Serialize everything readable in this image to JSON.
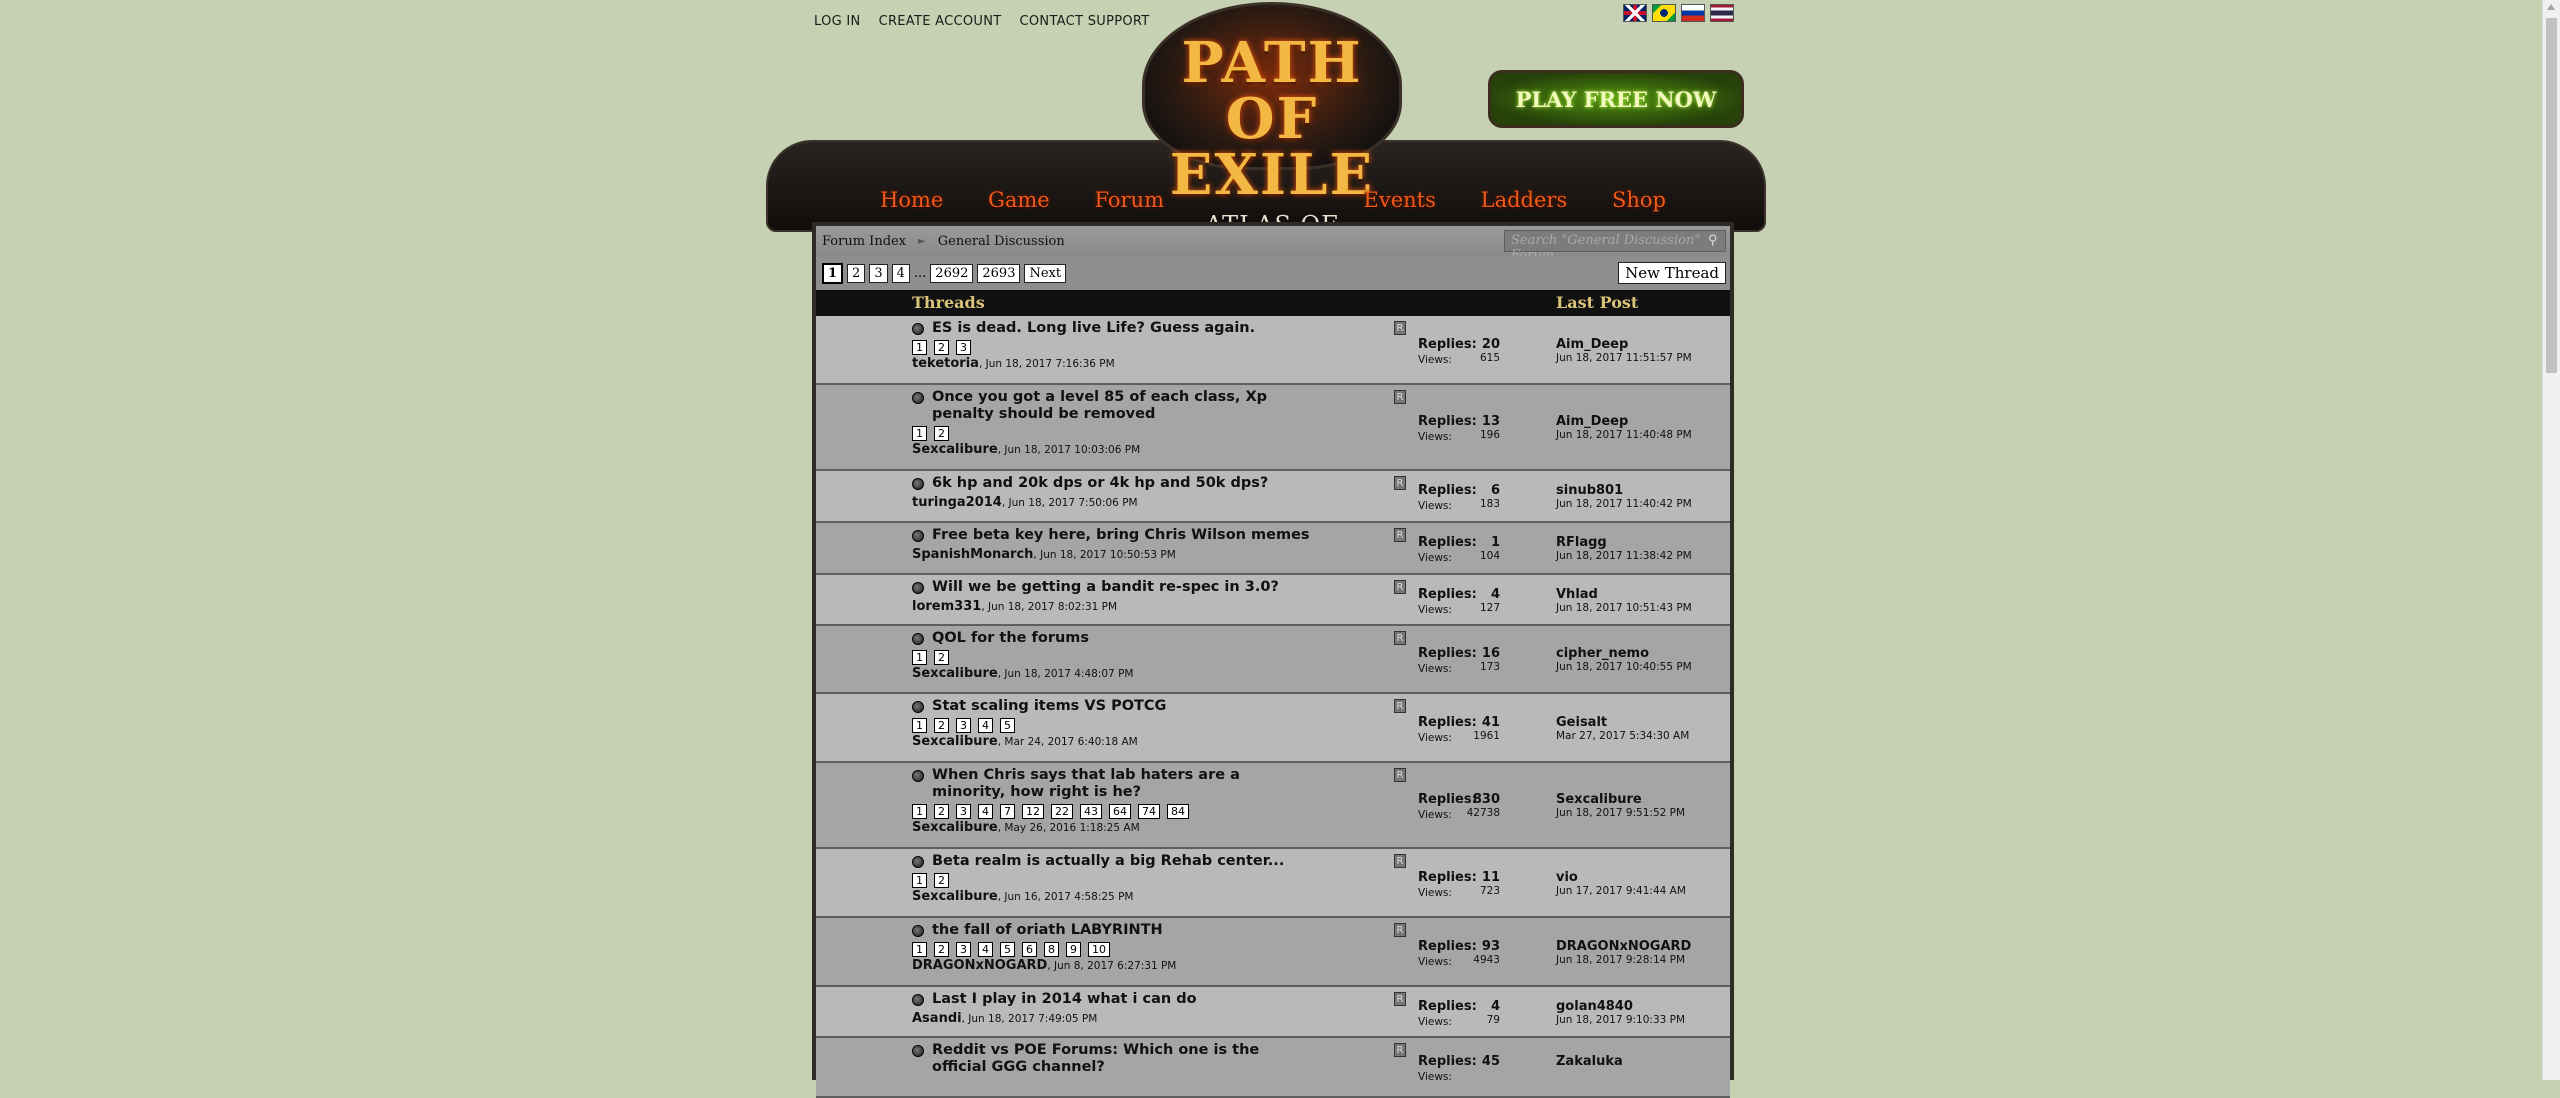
{
  "top_links": [
    "LOG IN",
    "CREATE ACCOUNT",
    "CONTACT SUPPORT"
  ],
  "flags": [
    "uk-flag",
    "brazil-flag",
    "russia-flag",
    "thailand-flag"
  ],
  "logo": {
    "main": "PATH OF EXILE",
    "sub": "ATLAS OF WORLDS"
  },
  "play_button": "PLAY FREE NOW",
  "nav": [
    "Home",
    "Game",
    "Forum",
    "Events",
    "Ladders",
    "Shop"
  ],
  "breadcrumb": {
    "root": "Forum Index",
    "current": "General Discussion"
  },
  "search": {
    "placeholder": "Search \"General Discussion\" Forum"
  },
  "pagination": {
    "pages": [
      "1",
      "2",
      "3",
      "4"
    ],
    "ellipsis": "...",
    "tail": [
      "2692",
      "2693"
    ],
    "next": "Next",
    "current": "1"
  },
  "new_thread": "New Thread",
  "table_headers": {
    "threads": "Threads",
    "last_post": "Last Post"
  },
  "labels": {
    "replies": "Replies:",
    "views": "Views:",
    "report": "R"
  },
  "threads": [
    {
      "title": "ES is dead. Long live Life? Guess again.",
      "pages": [
        "1",
        "2",
        "3"
      ],
      "author": "teketoria",
      "date": ", Jun 18, 2017 7:16:36 PM",
      "replies": "20",
      "views": "615",
      "last_user": "Aim_Deep",
      "last_date": "Jun 18, 2017 11:51:57 PM"
    },
    {
      "title": "Once you got a level 85 of each class, Xp penalty should be removed",
      "pages": [
        "1",
        "2"
      ],
      "author": "Sexcalibure",
      "date": ", Jun 18, 2017 10:03:06 PM",
      "replies": "13",
      "views": "196",
      "last_user": "Aim_Deep",
      "last_date": "Jun 18, 2017 11:40:48 PM"
    },
    {
      "title": "6k hp and 20k dps or 4k hp and 50k dps?",
      "pages": [],
      "author": "turinga2014",
      "date": ", Jun 18, 2017 7:50:06 PM",
      "replies": "6",
      "views": "183",
      "last_user": "sinub801",
      "last_date": "Jun 18, 2017 11:40:42 PM"
    },
    {
      "title": "Free beta key here, bring Chris Wilson memes",
      "pages": [],
      "author": "SpanishMonarch",
      "date": ", Jun 18, 2017 10:50:53 PM",
      "replies": "1",
      "views": "104",
      "last_user": "RFlagg",
      "last_date": "Jun 18, 2017 11:38:42 PM"
    },
    {
      "title": "Will we be getting a bandit re-spec in 3.0?",
      "pages": [],
      "author": "lorem331",
      "date": ", Jun 18, 2017 8:02:31 PM",
      "replies": "4",
      "views": "127",
      "last_user": "Vhlad",
      "last_date": "Jun 18, 2017 10:51:43 PM"
    },
    {
      "title": "QOL for the forums",
      "pages": [
        "1",
        "2"
      ],
      "author": "Sexcalibure",
      "date": ", Jun 18, 2017 4:48:07 PM",
      "replies": "16",
      "views": "173",
      "last_user": "cipher_nemo",
      "last_date": "Jun 18, 2017 10:40:55 PM"
    },
    {
      "title": "Stat scaling items VS POTCG",
      "pages": [
        "1",
        "2",
        "3",
        "4",
        "5"
      ],
      "author": "Sexcalibure",
      "date": ", Mar 24, 2017 6:40:18 AM",
      "replies": "41",
      "views": "1961",
      "last_user": "Geisalt",
      "last_date": "Mar 27, 2017 5:34:30 AM"
    },
    {
      "title": "When Chris says that lab haters are a minority, how right is he?",
      "pages": [
        "1",
        "2",
        "3",
        "4",
        "7",
        "12",
        "22",
        "43",
        "64",
        "74",
        "84"
      ],
      "author": "Sexcalibure",
      "date": ", May 26, 2016 1:18:25 AM",
      "replies": "830",
      "views": "42738",
      "last_user": "Sexcalibure",
      "last_date": "Jun 18, 2017 9:51:52 PM"
    },
    {
      "title": "Beta realm is actually a big Rehab center...",
      "pages": [
        "1",
        "2"
      ],
      "author": "Sexcalibure",
      "date": ", Jun 16, 2017 4:58:25 PM",
      "replies": "11",
      "views": "723",
      "last_user": "vio",
      "last_date": "Jun 17, 2017 9:41:44 AM"
    },
    {
      "title": "the fall of oriath LABYRINTH",
      "pages": [
        "1",
        "2",
        "3",
        "4",
        "5",
        "6",
        "8",
        "9",
        "10"
      ],
      "author": "DRAGONxNOGARD",
      "date": ", Jun 8, 2017 6:27:31 PM",
      "replies": "93",
      "views": "4943",
      "last_user": "DRAGONxNOGARD",
      "last_date": "Jun 18, 2017 9:28:14 PM"
    },
    {
      "title": "Last I play in 2014 what i can do",
      "pages": [],
      "author": "Asandi",
      "date": ", Jun 18, 2017 7:49:05 PM",
      "replies": "4",
      "views": "79",
      "last_user": "golan4840",
      "last_date": "Jun 18, 2017 9:10:33 PM"
    },
    {
      "title": "Reddit vs POE Forums: Which one is the official GGG channel?",
      "pages": [],
      "author": "",
      "date": "",
      "replies": "45",
      "views": "",
      "last_user": "Zakaluka",
      "last_date": ""
    }
  ]
}
